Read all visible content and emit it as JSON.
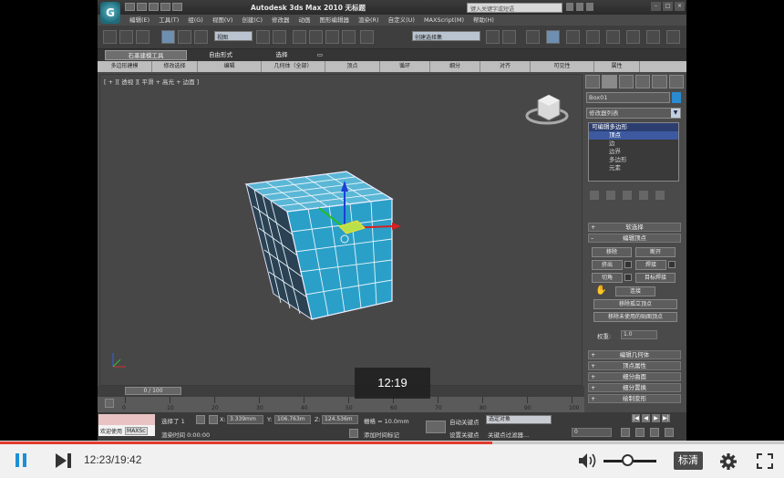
{
  "window": {
    "app_icon_label": "G",
    "title": "Autodesk 3ds Max   2010      无标题",
    "search_placeholder": "键入关键字或短语",
    "win_buttons": [
      "–",
      "□",
      "×"
    ]
  },
  "menubar": [
    "编辑(E)",
    "工具(T)",
    "组(G)",
    "视图(V)",
    "创建(C)",
    "修改器",
    "动画",
    "图形编辑器",
    "渲染(R)",
    "自定义(U)",
    "MAXScript(M)",
    "帮助(H)"
  ],
  "toolbar": {
    "filter_value": "全部",
    "view_value": "视图",
    "selection_set": "创建选择集"
  },
  "ribbon": {
    "tabs": [
      "石墨建模工具",
      "自由形式",
      "选择",
      "▭"
    ],
    "subtabs": [
      "多边形建模",
      "修改选择",
      "编辑",
      "几何体（全部）",
      "顶点",
      "循环",
      "细分",
      "对齐",
      "可见性",
      "属性"
    ]
  },
  "viewport": {
    "label": "[ + ][ 透视 ][ 平滑 + 高光 + 边面 ]",
    "slider_label": "0 / 100"
  },
  "timeline": {
    "ticks": [
      "0",
      "10",
      "20",
      "30",
      "40",
      "50",
      "60",
      "70",
      "80",
      "90",
      "100"
    ]
  },
  "status": {
    "welcome_label": "欢迎使用",
    "maxscript_label": "MAXSc",
    "selection_text": "选择了 1",
    "x_value": "3.339mm",
    "y_value": "106.763m",
    "z_value": "124.536m",
    "grid_text": "栅格 = 10.0mm",
    "autokey_label": "自动关键点",
    "setkey_label": "设置关键点",
    "filter_combo": "选定对象",
    "keyfilter_label": "关键点过滤器...",
    "prompt_text": "渲染时间  0:00:00",
    "add_time_tag": "添加时间标记",
    "frame_value": "0"
  },
  "command_panel": {
    "object_name": "Box01",
    "modifier_list": "修改器列表",
    "stack": [
      {
        "label": "可编辑多边形",
        "selected": true,
        "level": 0
      },
      {
        "label": "顶点",
        "selected": true,
        "level": 1
      },
      {
        "label": "边",
        "selected": false,
        "level": 1
      },
      {
        "label": "边界",
        "selected": false,
        "level": 1
      },
      {
        "label": "多边形",
        "selected": false,
        "level": 1
      },
      {
        "label": "元素",
        "selected": false,
        "level": 1
      }
    ],
    "rollouts": {
      "soft_select": "软选择",
      "edit_vertices": "编辑顶点",
      "remove": "移除",
      "break": "断开",
      "extrude": "挤出",
      "weld": "焊接",
      "chamfer": "切角",
      "target_weld": "目标焊接",
      "connect": "连接",
      "remove_isolated": "移除孤立顶点",
      "remove_unused_map": "移除未使用的贴图顶点",
      "weight_label": "权重:",
      "weight_value": "1.0",
      "edit_geometry": "编辑几何体",
      "vertex_props": "顶点属性",
      "subdiv_surface": "细分曲面",
      "subdiv_displace": "细分置换",
      "paint_deform": "绘制变形"
    }
  },
  "player": {
    "time": "12:23/19:42",
    "tooltip_time": "12:19",
    "quality": "标清",
    "progress_fraction": 0.628,
    "volume_fraction": 0.45
  }
}
